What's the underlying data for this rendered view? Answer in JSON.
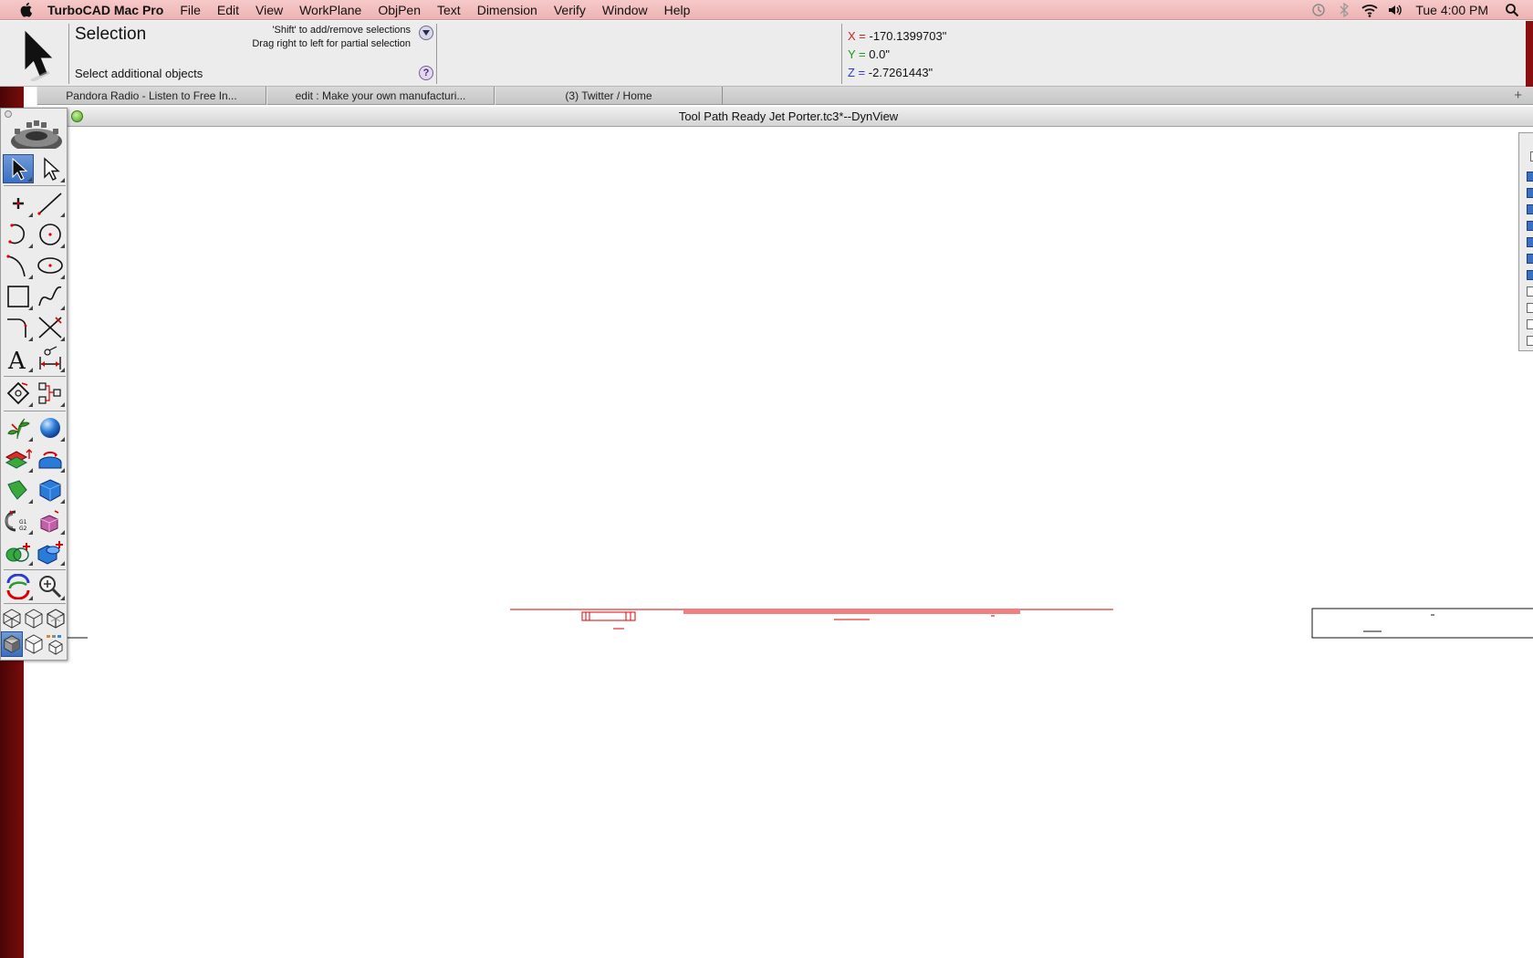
{
  "menubar": {
    "app_name": "TurboCAD Mac Pro",
    "items": [
      "File",
      "Edit",
      "View",
      "WorkPlane",
      "ObjPen",
      "Text",
      "Dimension",
      "Verify",
      "Window",
      "Help"
    ],
    "clock": "Tue 4:00 PM",
    "status_icons": [
      "time-machine-icon",
      "bluetooth-icon",
      "wifi-icon",
      "volume-icon",
      "spotlight-icon"
    ]
  },
  "toolbar": {
    "tool_name": "Selection",
    "hint_shift": "'Shift' to add/remove selections",
    "hint_drag": "Drag right to left for partial selection",
    "prompt": "Select additional objects",
    "help_label": "?"
  },
  "coords": {
    "x_label": "X =",
    "x_value": "-170.1399703\"",
    "y_label": "Y =",
    "y_value": "0.0\"",
    "z_label": "Z =",
    "z_value": "-2.7261443\"",
    "x_color": "#d42020",
    "y_color": "#1d9a1d",
    "z_color": "#2a3ad8"
  },
  "tabs": [
    {
      "label": "Pandora Radio - Listen to Free In..."
    },
    {
      "label": "edit : Make your own manufacturi..."
    },
    {
      "label": "(3) Twitter / Home"
    }
  ],
  "tab_add_label": "+",
  "document": {
    "title": "Tool Path Ready Jet Porter.tc3*--DynView"
  },
  "colors": {
    "drawing_red": "#e00000",
    "desktop_red": "#7a0c0c",
    "selected_tool": "#3b6fc2"
  }
}
